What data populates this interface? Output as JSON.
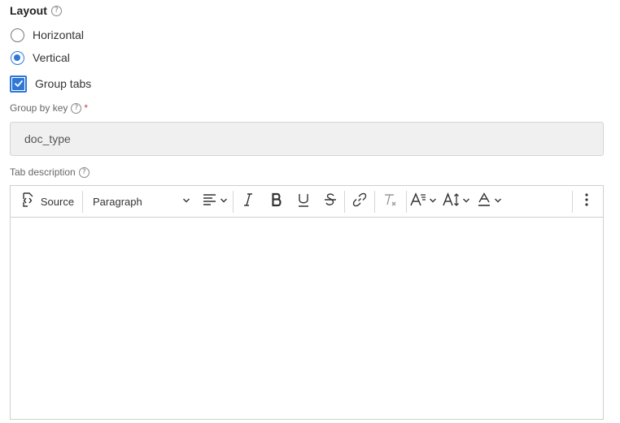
{
  "layout": {
    "title": "Layout",
    "help_glyph": "?",
    "options": [
      {
        "label": "Horizontal",
        "selected": false
      },
      {
        "label": "Vertical",
        "selected": true
      }
    ]
  },
  "group_tabs": {
    "label": "Group tabs",
    "checked": true
  },
  "group_by_key": {
    "label": "Group by key",
    "required_marker": "*",
    "value": "doc_type"
  },
  "tab_description": {
    "label": "Tab description",
    "toolbar": {
      "source_label": "Source",
      "paragraph_label": "Paragraph",
      "icons": [
        "source-icon",
        "align-icon",
        "italic-icon",
        "bold-icon",
        "underline-icon",
        "strikethrough-icon",
        "link-icon",
        "clear-format-icon",
        "font-family-icon",
        "font-size-icon",
        "font-color-icon",
        "more-vertical-icon"
      ]
    },
    "content": ""
  },
  "colors": {
    "accent": "#2f78d6",
    "required": "#d23c3c"
  }
}
